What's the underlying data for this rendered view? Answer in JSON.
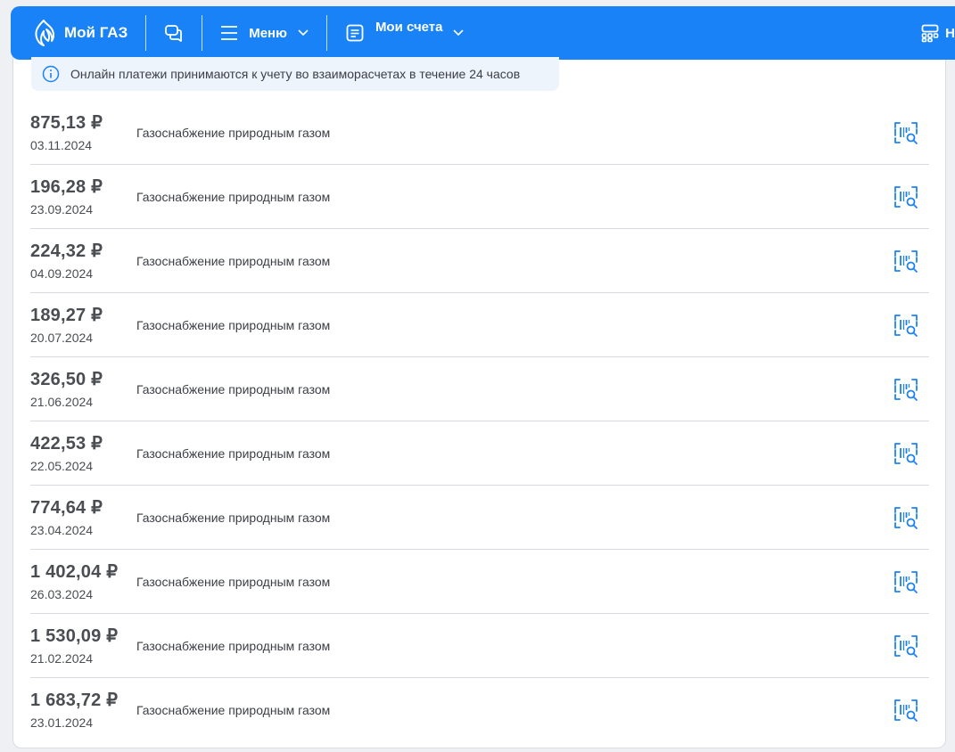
{
  "header": {
    "brand": "Мой ГАЗ",
    "menu_label": "Меню",
    "accounts_label": "Мои счета",
    "right_label": "Н"
  },
  "notice": {
    "text": "Онлайн платежи принимаются к учету во взаиморасчетах в течение 24 часов"
  },
  "colors": {
    "brand_blue": "#1a82f7",
    "icon_blue": "#1a82f7",
    "text_dark": "#4a4d52"
  },
  "payments": [
    {
      "amount": "875,13 ₽",
      "date": "03.11.2024",
      "description": "Газоснабжение природным газом"
    },
    {
      "amount": "196,28 ₽",
      "date": "23.09.2024",
      "description": "Газоснабжение природным газом"
    },
    {
      "amount": "224,32 ₽",
      "date": "04.09.2024",
      "description": "Газоснабжение природным газом"
    },
    {
      "amount": "189,27 ₽",
      "date": "20.07.2024",
      "description": "Газоснабжение природным газом"
    },
    {
      "amount": "326,50 ₽",
      "date": "21.06.2024",
      "description": "Газоснабжение природным газом"
    },
    {
      "amount": "422,53 ₽",
      "date": "22.05.2024",
      "description": "Газоснабжение природным газом"
    },
    {
      "amount": "774,64 ₽",
      "date": "23.04.2024",
      "description": "Газоснабжение природным газом"
    },
    {
      "amount": "1 402,04 ₽",
      "date": "26.03.2024",
      "description": "Газоснабжение природным газом"
    },
    {
      "amount": "1 530,09 ₽",
      "date": "21.02.2024",
      "description": "Газоснабжение природным газом"
    },
    {
      "amount": "1 683,72 ₽",
      "date": "23.01.2024",
      "description": "Газоснабжение природным газом"
    }
  ]
}
